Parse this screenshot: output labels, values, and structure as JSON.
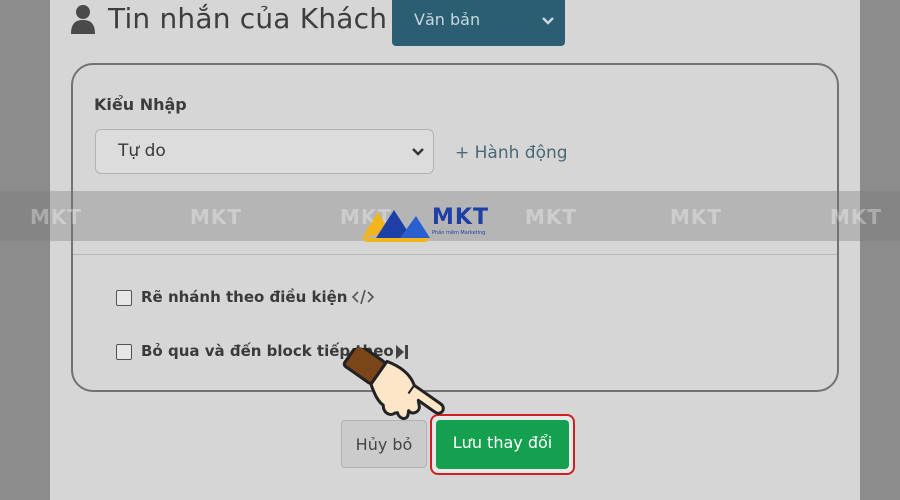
{
  "header": {
    "title": "Tin nhắn của Khách",
    "type_select_value": "Văn bản"
  },
  "form": {
    "input_type_label": "Kiểu Nhập",
    "mode_select_value": "Tự do",
    "add_action_label": "+ Hành động",
    "branch_checkbox_label": "Rẽ nhánh theo điều kiện",
    "skip_checkbox_label": "Bỏ qua và đến block tiếp theo"
  },
  "buttons": {
    "cancel_label": "Hủy bỏ",
    "save_label": "Lưu thay đổi"
  },
  "watermark": {
    "brand": "MKT",
    "repeats": [
      "MKT",
      "MKT",
      "MKT",
      "MKT",
      "MKT",
      "MKT"
    ]
  },
  "logo": {
    "name": "MKT",
    "tagline": "Phần mềm Marketing"
  },
  "colors": {
    "accent_dark": "#2b5d73",
    "save_green": "#15a04f",
    "highlight_red": "#d01f1f",
    "logo_blue": "#1e3fa6",
    "logo_yellow": "#f2b51c"
  },
  "icons": {
    "user": "user-icon",
    "code": "code-icon",
    "skip": "skip-forward-icon",
    "chevron": "chevron-down-icon",
    "pointer": "pointing-hand-icon"
  }
}
